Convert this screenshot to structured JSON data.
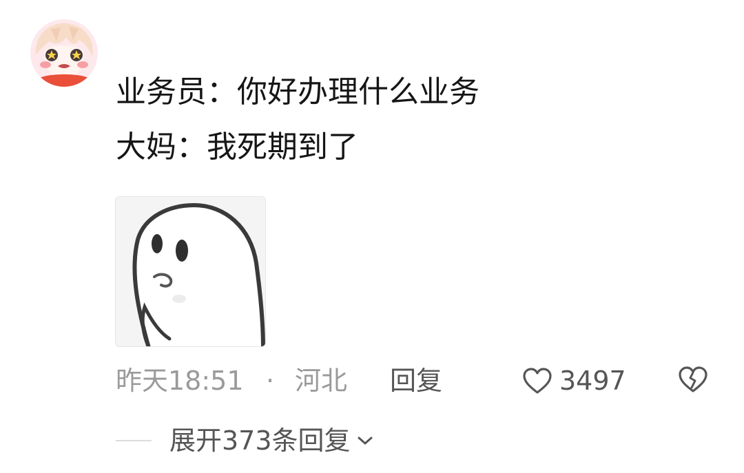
{
  "comment": {
    "author_avatar_icon": "anime-girl-avatar-icon",
    "lines": [
      "业务员：你好办理什么业务",
      "大妈：我死期到了"
    ],
    "sticker_icon": "ghost-sticker-icon"
  },
  "meta": {
    "time": "昨天18:51",
    "separator": "·",
    "location": "河北",
    "reply_label": "回复"
  },
  "actions": {
    "like_icon": "heart-outline-icon",
    "like_count": "3497",
    "dislike_icon": "broken-heart-icon"
  },
  "replies": {
    "expand_label": "展开373条回复",
    "expand_icon": "chevron-down-icon"
  },
  "colors": {
    "text_primary": "#161616",
    "text_secondary": "#9a9a9a",
    "text_action": "#555555",
    "avatar_blush": "#f27d7d"
  }
}
